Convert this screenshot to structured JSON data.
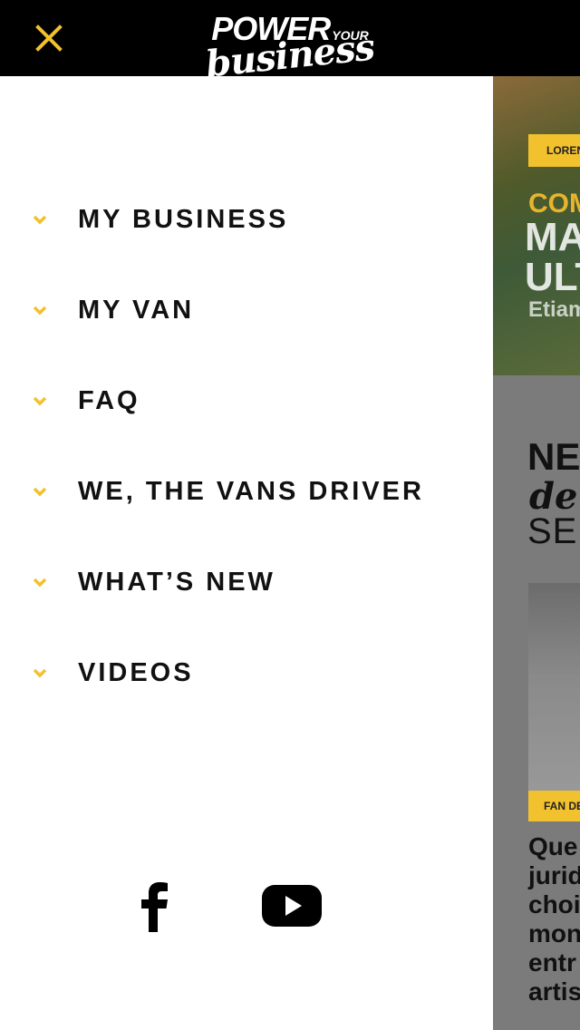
{
  "app": {
    "logo_line1": "POWER",
    "logo_your": "YOUR",
    "logo_line2": "business"
  },
  "colors": {
    "accent": "#F2C12E",
    "topbar": "#000000",
    "drawer": "#FFFFFF",
    "text": "#111111"
  },
  "icons": {
    "close": "close-icon",
    "chevron": "chevron-down-icon",
    "facebook": "facebook-icon",
    "youtube": "youtube-icon"
  },
  "menu": {
    "items": [
      {
        "label": "MY BUSINESS"
      },
      {
        "label": "MY VAN"
      },
      {
        "label": "FAQ"
      },
      {
        "label": "WE, THE VANS DRIVER"
      },
      {
        "label": "WHAT’S NEW"
      },
      {
        "label": "VIDEOS"
      }
    ]
  },
  "background": {
    "hero_tag": "LOREN",
    "hero_kicker": "COM",
    "hero_title_1": "MA",
    "hero_title_2": "ULT",
    "hero_sub": "Etiam",
    "news_title_1": "NE",
    "news_title_2": "de",
    "news_title_3": "SEN",
    "news_tag": "FAN DE",
    "news_text": [
      "Que",
      "jurid",
      "choi",
      "mon",
      "entr",
      "artis"
    ]
  }
}
